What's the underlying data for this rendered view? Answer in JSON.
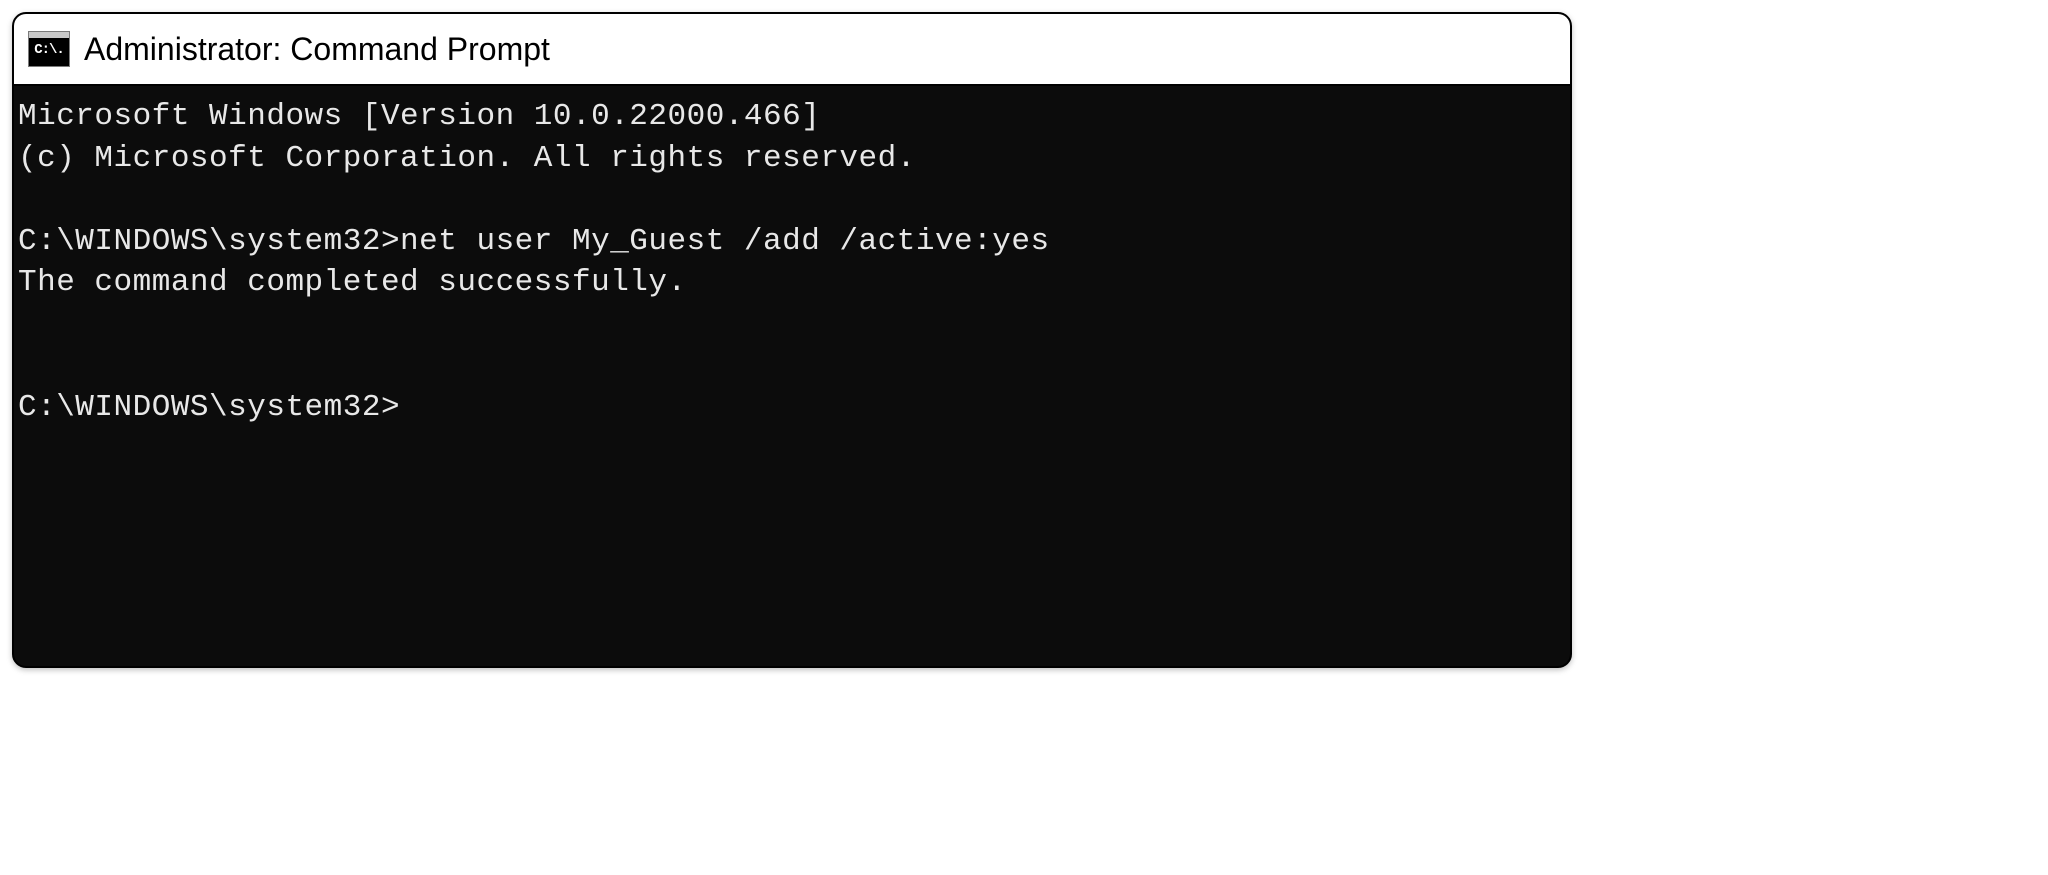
{
  "window": {
    "icon_glyph": "C:\\.",
    "title": "Administrator: Command Prompt"
  },
  "terminal": {
    "lines": {
      "l0": "Microsoft Windows [Version 10.0.22000.466]",
      "l1": "(c) Microsoft Corporation. All rights reserved.",
      "l2": "C:\\WINDOWS\\system32>net user My_Guest /add /active:yes",
      "l3": "The command completed successfully.",
      "l4": "C:\\WINDOWS\\system32>"
    }
  }
}
